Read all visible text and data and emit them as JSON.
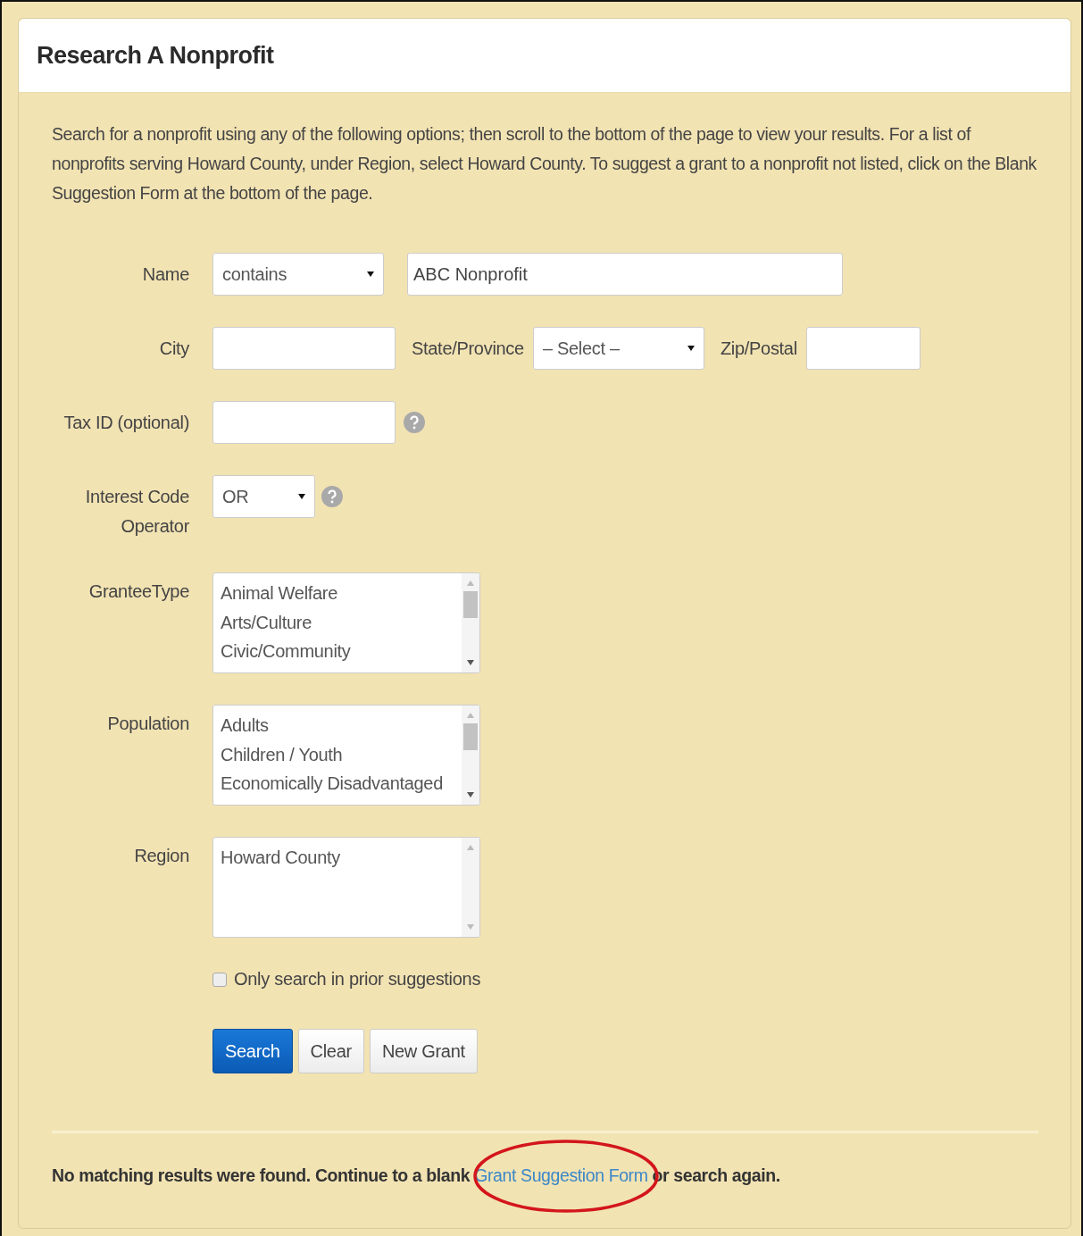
{
  "panel": {
    "title": "Research A Nonprofit"
  },
  "intro": "Search for a nonprofit using any of the following options; then scroll to the bottom of the page to view your results. For a list of nonprofits serving Howard County, under Region, select Howard County. To suggest a grant to a nonprofit not listed, click on the Blank Suggestion Form at the bottom of the page.",
  "name_row": {
    "label": "Name",
    "operator": "contains",
    "value": "ABC Nonprofit"
  },
  "location_row": {
    "city_label": "City",
    "state_label": "State/Province",
    "state_value": "– Select –",
    "zip_label": "Zip/Postal"
  },
  "tax_id": {
    "label": "Tax ID (optional)"
  },
  "interest_code": {
    "label": "Interest Code Operator",
    "value": "OR"
  },
  "lists": [
    {
      "label": "GranteeType",
      "options": [
        "Animal Welfare",
        "Arts/Culture",
        "Civic/Community"
      ]
    },
    {
      "label": "Population",
      "options": [
        "Adults",
        "Children / Youth",
        "Economically Disadvantaged"
      ]
    },
    {
      "label": "Region",
      "options": [
        "Howard County"
      ]
    }
  ],
  "prior_only": {
    "label": "Only search in prior suggestions",
    "checked": false
  },
  "buttons": [
    {
      "label": "Search",
      "kind": "primary"
    },
    {
      "label": "Clear",
      "kind": "default"
    },
    {
      "label": "New Grant",
      "kind": "default"
    }
  ],
  "footer": {
    "before": "No matching results were found. Continue to a blank",
    "link": "Grant Suggestion Form",
    "after": "or search again."
  }
}
